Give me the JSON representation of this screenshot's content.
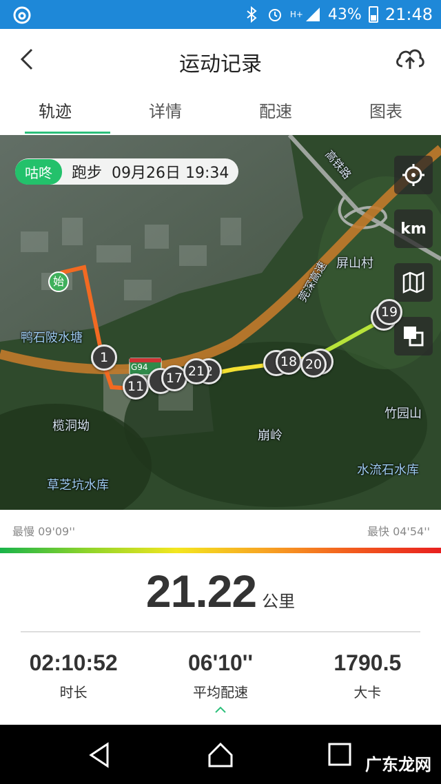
{
  "statusbar": {
    "battery": "43%",
    "time": "21:48",
    "signal_label": "H+"
  },
  "header": {
    "title": "运动记录"
  },
  "tabs": [
    {
      "label": "轨迹"
    },
    {
      "label": "详情"
    },
    {
      "label": "配速"
    },
    {
      "label": "图表"
    }
  ],
  "map": {
    "info": {
      "tag": "咕咚",
      "type": "跑步",
      "datetime": "09月26日 19:34"
    },
    "controls": {
      "km": "km"
    },
    "start_label": "始",
    "road_sign": "G94",
    "markers": [
      "1",
      "11",
      "17",
      "21",
      "2",
      "18",
      "20",
      "19"
    ],
    "places": {
      "a": "鸭石陂水塘",
      "b": "榄洞坳",
      "c": "崩岭",
      "d": "竹园山",
      "e": "水流石水库",
      "f": "草芝坑水库",
      "g": "屏山村",
      "h": "高铁路",
      "i": "莞深高速"
    }
  },
  "speed": {
    "slowest": "最慢 09'09''",
    "fastest": "最快 04'54''"
  },
  "summary": {
    "distance": "21.22",
    "distance_unit": "公里"
  },
  "stats": [
    {
      "value": "02:10:52",
      "label": "时长"
    },
    {
      "value": "06'10''",
      "label": "平均配速"
    },
    {
      "value": "1790.5",
      "label": "大卡"
    }
  ],
  "watermark": "广东龙网",
  "colors": {
    "accent": "#2cbf7a",
    "statusbar": "#1e88d8",
    "tag": "#23c16b"
  }
}
